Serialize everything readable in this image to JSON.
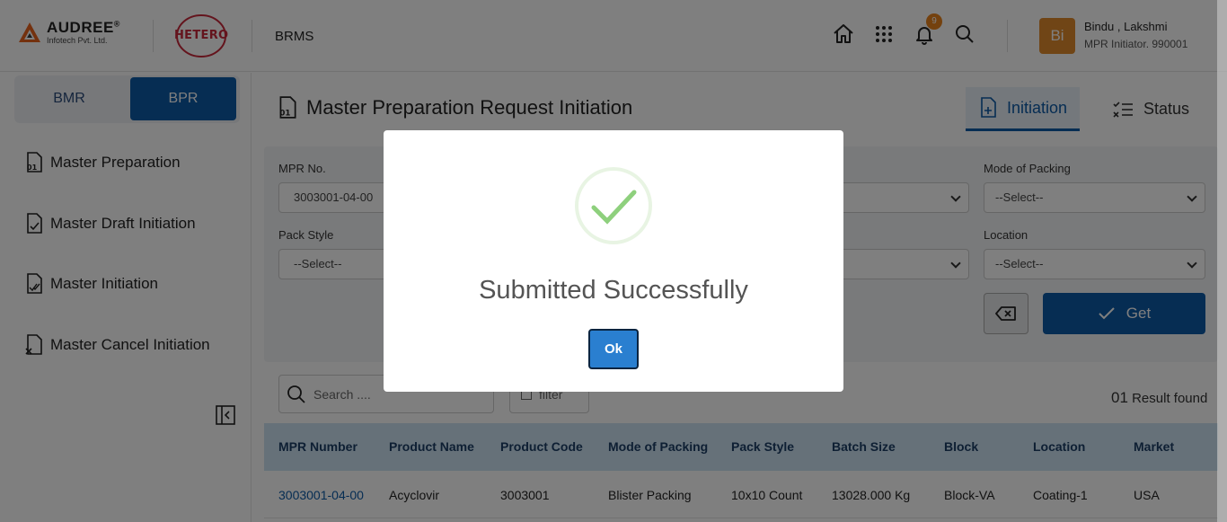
{
  "header": {
    "brand_name": "AUDREE",
    "brand_mark": "®",
    "brand_sub": "Infotech Pvt. Ltd.",
    "partner_logo": "HETERO",
    "app_name": "BRMS",
    "notification_count": "9",
    "user": {
      "initials": "Bi",
      "name": "Bindu , Lakshmi",
      "role": "MPR Initiator. 990001"
    },
    "icons": [
      "home-icon",
      "apps-grid-icon",
      "bell-icon",
      "search-icon"
    ]
  },
  "sidebar": {
    "toggle": [
      "BMR",
      "BPR"
    ],
    "active_toggle": "BPR",
    "items": [
      {
        "label": "Master Preparation",
        "icon": "document-01-icon"
      },
      {
        "label": "Master Draft Initiation",
        "icon": "document-check-icon"
      },
      {
        "label": "Master Initiation",
        "icon": "document-double-check-icon"
      },
      {
        "label": "Master Cancel Initiation",
        "icon": "document-cancel-icon"
      }
    ]
  },
  "main": {
    "title": "Master Preparation Request Initiation",
    "tabs": [
      {
        "label": "Initiation",
        "active": true
      },
      {
        "label": "Status",
        "active": false
      }
    ],
    "filters": {
      "mpr_no_label": "MPR No.",
      "mpr_no_value": "3003001-04-00",
      "mode_of_packing_label": "Mode of Packing",
      "mode_of_packing_value": "--Select--",
      "pack_style_label": "Pack Style",
      "pack_style_value": "--Select--",
      "location_label": "Location",
      "location_value": "--Select--"
    },
    "get_label": "Get",
    "search_placeholder": "Search ....",
    "filter_label": "filter",
    "result_count": "01",
    "result_text": "Result found",
    "table": {
      "headers": [
        "MPR Number",
        "Product Name",
        "Product Code",
        "Mode of Packing",
        "Pack Style",
        "Batch Size",
        "Block",
        "Location",
        "Market"
      ],
      "rows": [
        [
          "3003001-04-00",
          "Acyclovir",
          "3003001",
          "Blister Packing",
          "10x10 Count",
          "13028.000 Kg",
          "Block-VA",
          "Coating-1",
          "USA"
        ]
      ]
    }
  },
  "modal": {
    "title": "Submitted Successfully",
    "ok_label": "Ok",
    "success_color": "#8ed07d"
  }
}
